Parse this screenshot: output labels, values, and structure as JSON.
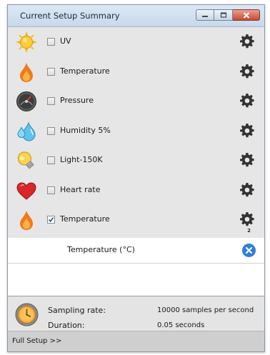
{
  "window": {
    "title": "Current Setup Summary",
    "buttons": [
      "minimize",
      "maximize",
      "close"
    ]
  },
  "sensors": [
    {
      "icon": "sun-icon",
      "label": "UV",
      "checked": false
    },
    {
      "icon": "flame-icon",
      "label": "Temperature",
      "checked": false
    },
    {
      "icon": "gauge-icon",
      "label": "Pressure",
      "checked": false
    },
    {
      "icon": "water-drops-icon",
      "label": "Humidity 5%",
      "checked": false
    },
    {
      "icon": "light-bulb-icon",
      "label": "Light-150K",
      "checked": false
    },
    {
      "icon": "heart-icon",
      "label": "Heart rate",
      "checked": false
    },
    {
      "icon": "flame-icon",
      "label": "Temperature",
      "checked": true,
      "badge": "2"
    }
  ],
  "selected_measurement": {
    "label": "Temperature (°C)",
    "action_icon": "remove-icon"
  },
  "footer": {
    "sampling_label": "Sampling rate:",
    "sampling_value": "10000 samples per second",
    "duration_label": "Duration:",
    "duration_value": "0.05 seconds",
    "link_label": "Full Setup >>"
  },
  "colors": {
    "list_background": "#e6e6e6",
    "remove_button": "#2f7fd6",
    "close_button": "#c64a35"
  }
}
